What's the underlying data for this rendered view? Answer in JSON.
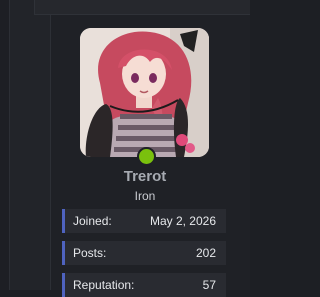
{
  "profile": {
    "username": "Trerot",
    "rank": "Iron",
    "avatar_alt": "user-avatar",
    "status_color": "#7ac10d",
    "stats": [
      {
        "label": "Joined:",
        "value": "May 2, 2026"
      },
      {
        "label": "Posts:",
        "value": "202"
      },
      {
        "label": "Reputation:",
        "value": "57"
      }
    ]
  },
  "colors": {
    "background": "#1d1f24",
    "stat_accent": "#4f63bf",
    "username": "#a7abb2"
  }
}
